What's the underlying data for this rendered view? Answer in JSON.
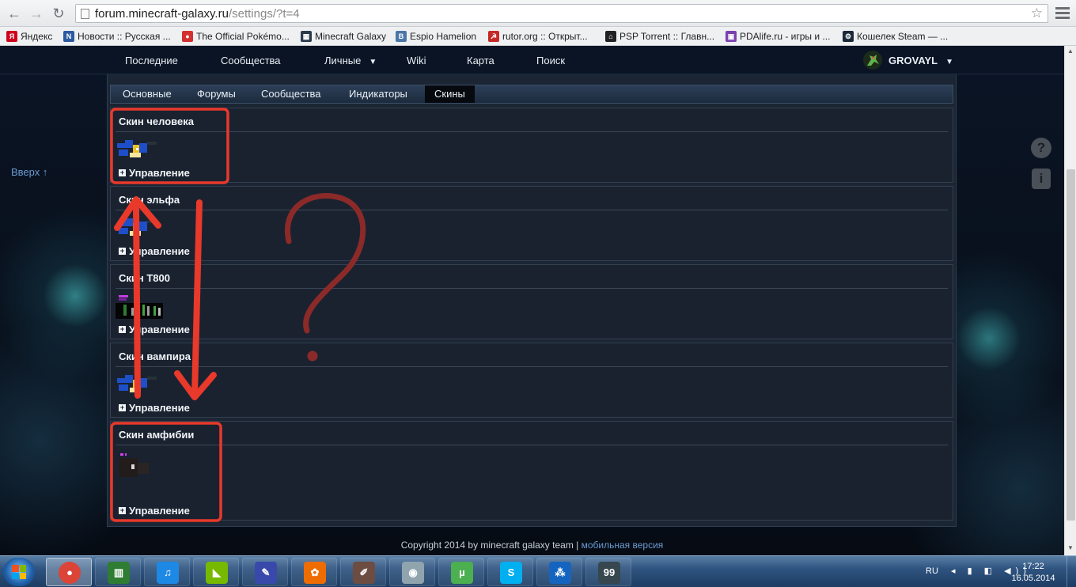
{
  "browser": {
    "url_host": "forum.minecraft-galaxy.ru",
    "url_path": "/settings/?t=4",
    "bookmarks": [
      {
        "label": "Яндекс",
        "icon": "yandex-icon",
        "color": "#d0021b",
        "glyph": "Я"
      },
      {
        "label": "Новости :: Русская ...",
        "icon": "news-icon",
        "color": "#2c5aa0",
        "glyph": "N"
      },
      {
        "label": "The Official Pokémo...",
        "icon": "pokeball-icon",
        "color": "#d32f2f",
        "glyph": "●"
      },
      {
        "label": "Minecraft Galaxy",
        "icon": "creeper-icon",
        "color": "#2a3a4a",
        "glyph": "▦"
      },
      {
        "label": "Espio Hamelion",
        "icon": "vk-icon",
        "color": "#4a76a8",
        "glyph": "B"
      },
      {
        "label": "rutor.org :: Открыт...",
        "icon": "rutor-icon",
        "color": "#c62828",
        "glyph": "☭"
      },
      {
        "label": "PSP Torrent :: Главн...",
        "icon": "gamepad-icon",
        "color": "#222",
        "glyph": "⌂"
      },
      {
        "label": "PDAlife.ru - игры и ...",
        "icon": "pdalife-icon",
        "color": "#7b3fb0",
        "glyph": "▣"
      },
      {
        "label": "Кошелек Steam — ...",
        "icon": "steam-icon",
        "color": "#1b2838",
        "glyph": "⚙"
      }
    ]
  },
  "site": {
    "nav": [
      {
        "label": "Последние"
      },
      {
        "label": "Сообщества"
      },
      {
        "label": "Личные",
        "dropdown": true
      },
      {
        "label": "Wiki"
      },
      {
        "label": "Карта"
      },
      {
        "label": "Поиск"
      }
    ],
    "username": "GROVAYL",
    "up_link": "Вверх ↑",
    "help_glyph": "?",
    "info_glyph": "i"
  },
  "settings": {
    "tabs": [
      {
        "label": "Основные",
        "active": false
      },
      {
        "label": "Форумы",
        "active": false
      },
      {
        "label": "Сообщества",
        "active": false
      },
      {
        "label": "Индикаторы",
        "active": false
      },
      {
        "label": "Скины",
        "active": true
      }
    ],
    "manage_label": "Управление",
    "sections": [
      {
        "title": "Скин человека",
        "skin": "skin-human"
      },
      {
        "title": "Скин эльфа",
        "skin": "skin-elf"
      },
      {
        "title": "Скин T800",
        "skin": "skin-t800"
      },
      {
        "title": "Скин вампира",
        "skin": "skin-vampire"
      },
      {
        "title": "Скин амфибии",
        "skin": "skin-amphibian"
      }
    ]
  },
  "footer": {
    "copyright": "Copyright 2014 by minecraft galaxy team |",
    "mobile_link": "мобильная версия"
  },
  "annotation": {
    "question_mark": "?",
    "color": "#e8392b",
    "question_color": "#8b2a28"
  },
  "taskbar": {
    "apps": [
      {
        "name": "chrome",
        "color": "#db4437",
        "glyph": "●",
        "active": true
      },
      {
        "name": "system-monitor",
        "color": "#2e7d32",
        "glyph": "▥"
      },
      {
        "name": "music-app",
        "color": "#1e88e5",
        "glyph": "♫"
      },
      {
        "name": "nvidia",
        "color": "#76b900",
        "glyph": "◣"
      },
      {
        "name": "editor",
        "color": "#3949ab",
        "glyph": "✎"
      },
      {
        "name": "paint",
        "color": "#ef6c00",
        "glyph": "✿"
      },
      {
        "name": "pencils",
        "color": "#6d4c41",
        "glyph": "✐"
      },
      {
        "name": "camera",
        "color": "#90a4ae",
        "glyph": "◉"
      },
      {
        "name": "utorrent",
        "color": "#4caf50",
        "glyph": "µ"
      },
      {
        "name": "skype",
        "color": "#00aff0",
        "glyph": "S"
      },
      {
        "name": "network",
        "color": "#1565c0",
        "glyph": "⁂"
      },
      {
        "name": "score-app",
        "color": "#37474f",
        "glyph": "99"
      }
    ],
    "lang": "RU",
    "time": "17:22",
    "date": "16.05.2014"
  }
}
